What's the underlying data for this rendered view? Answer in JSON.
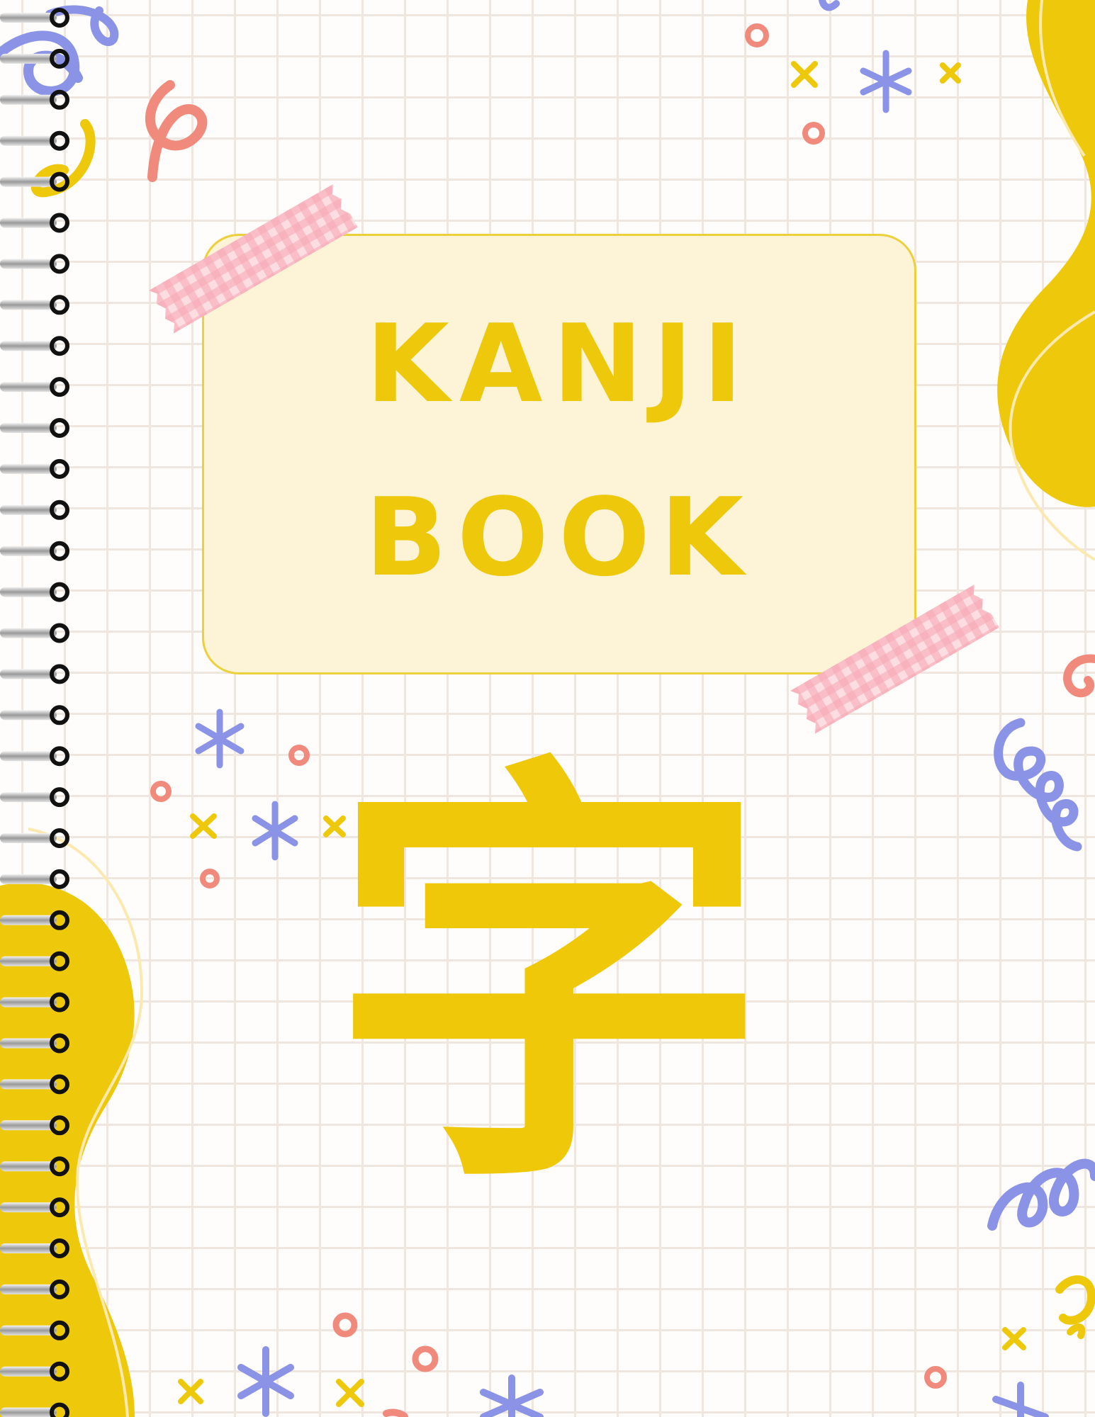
{
  "cover": {
    "title_line_1": "KANJI",
    "title_line_2": "BOOK",
    "kanji_character": "字"
  },
  "colors": {
    "accent_yellow": "#efc80a",
    "card_fill": "#fdf3d6",
    "grid_line": "#efe7df",
    "washi_pink": "#f6b6bd",
    "confetti_blue": "#8a93e6",
    "confetti_coral": "#f08a7c"
  },
  "decorations": {
    "icons": [
      "spiral-binding-icon",
      "washi-tape-icon",
      "sparkle-star-icon",
      "squiggle-icon",
      "dot-icon",
      "cross-icon",
      "blob-shape-icon"
    ]
  }
}
